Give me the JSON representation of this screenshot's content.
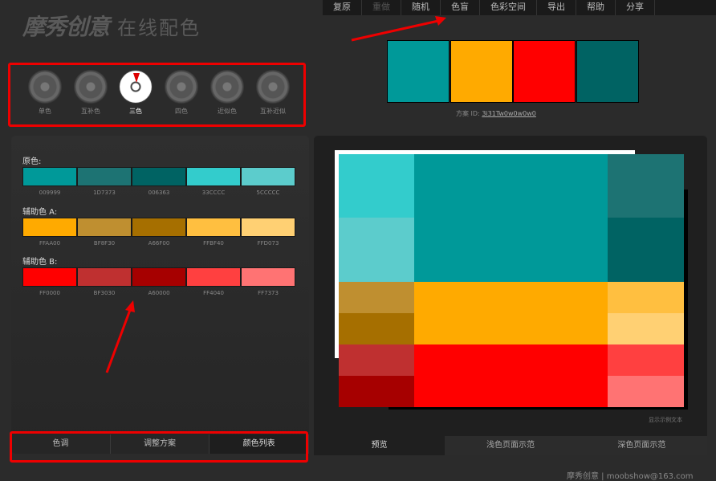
{
  "logo": {
    "brand": "摩秀创意",
    "subtitle": "在线配色"
  },
  "menu": [
    {
      "label": "复原",
      "disabled": false
    },
    {
      "label": "重做",
      "disabled": true
    },
    {
      "label": "随机",
      "disabled": false
    },
    {
      "label": "色盲",
      "disabled": false
    },
    {
      "label": "色彩空间",
      "disabled": false
    },
    {
      "label": "导出",
      "disabled": false
    },
    {
      "label": "帮助",
      "disabled": false
    },
    {
      "label": "分享",
      "disabled": false
    }
  ],
  "top_swatches": [
    "#009999",
    "#FFAA00",
    "#FF0000",
    "#006363"
  ],
  "scheme": {
    "label": "方案 ID:",
    "id": "3i31Tw0w0w0w0"
  },
  "wheels": [
    {
      "label": "单色",
      "active": false
    },
    {
      "label": "互补色",
      "active": false
    },
    {
      "label": "三色",
      "active": true
    },
    {
      "label": "四色",
      "active": false
    },
    {
      "label": "近似色",
      "active": false
    },
    {
      "label": "互补近似",
      "active": false
    }
  ],
  "groups": [
    {
      "label": "原色:",
      "colors": [
        "009999",
        "1D7373",
        "006363",
        "33CCCC",
        "5CCCCC"
      ]
    },
    {
      "label": "辅助色 A:",
      "colors": [
        "FFAA00",
        "BF8F30",
        "A66F00",
        "FFBF40",
        "FFD073"
      ]
    },
    {
      "label": "辅助色 B:",
      "colors": [
        "FF0000",
        "BF3030",
        "A60000",
        "FF4040",
        "FF7373"
      ]
    }
  ],
  "left_tabs": [
    {
      "label": "色调",
      "active": false
    },
    {
      "label": "调整方案",
      "active": false
    },
    {
      "label": "颜色列表",
      "active": true
    }
  ],
  "right_tabs": [
    {
      "label": "预览",
      "active": true
    },
    {
      "label": "浅色页面示范",
      "active": false
    },
    {
      "label": "深色页面示范",
      "active": false
    }
  ],
  "demo_text": "显示示例文本",
  "footer": "摩秀创意 | moobshow@163.com",
  "annotation_color": "#ee0000"
}
